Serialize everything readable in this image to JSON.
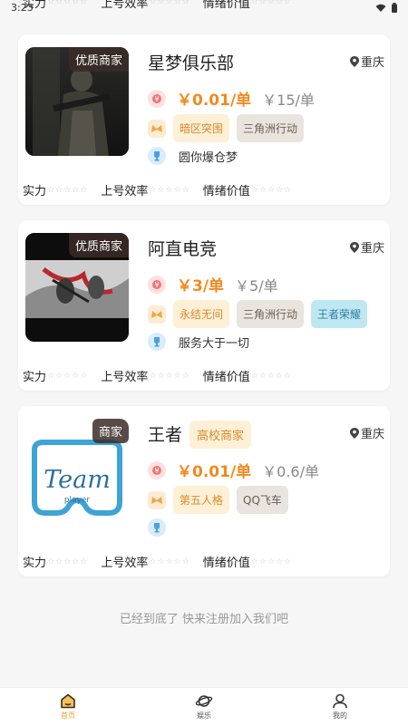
{
  "status": {
    "time": "3:23"
  },
  "cut_row": {
    "label1": "实力",
    "label2": "上号效率",
    "label3": "情绪价值",
    "stars": "☆☆☆☆☆"
  },
  "cards": [
    {
      "badge": "优质商家",
      "name": "星梦俱乐部",
      "location": "重庆",
      "price": "￥0.01/单",
      "old_price": "￥15/单",
      "tags": [
        "暗区突围",
        "三角洲行动"
      ],
      "slogan": "圆你爆仓梦",
      "ratings": [
        "实力",
        "上号效率",
        "情绪价值"
      ],
      "stars": "☆☆☆☆☆"
    },
    {
      "badge": "优质商家",
      "name": "阿直电竞",
      "location": "重庆",
      "price": "￥3/单",
      "old_price": "￥5/单",
      "tags": [
        "永结无间",
        "三角洲行动",
        "王者荣耀"
      ],
      "slogan": "服务大于一切",
      "ratings": [
        "实力",
        "上号效率",
        "情绪价值"
      ],
      "stars": "☆☆☆☆☆"
    },
    {
      "badge": "商家",
      "name": "王者",
      "name_tag": "高校商家",
      "location": "重庆",
      "price": "￥0.01/单",
      "old_price": "￥0.6/单",
      "tags": [
        "第五人格",
        "QQ飞车"
      ],
      "slogan": "",
      "ratings": [
        "实力",
        "上号效率",
        "情绪价值"
      ],
      "stars": "☆☆☆☆☆",
      "logo_text": "Team",
      "logo_sub": "player"
    }
  ],
  "end_text": "已经到底了 快来注册加入我们吧",
  "tabbar": [
    {
      "label": "首页",
      "icon": "home-icon",
      "active": true
    },
    {
      "label": "娱乐",
      "icon": "planet-icon",
      "active": false
    },
    {
      "label": "我的",
      "icon": "user-icon",
      "active": false
    }
  ],
  "colors": {
    "accent": "#f28a1e",
    "tag_yellow": "#fdf0d6",
    "tag_gray": "#e9e4de",
    "tag_blue": "#bfe7f2",
    "tab_active": "#e8a23a"
  }
}
